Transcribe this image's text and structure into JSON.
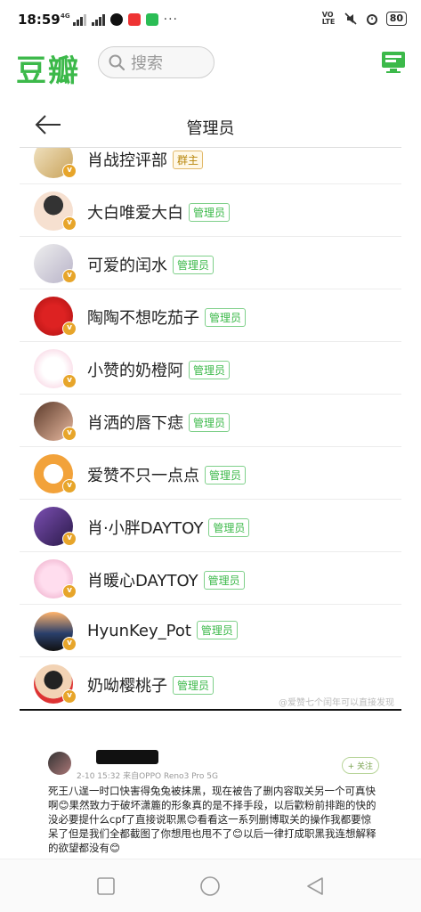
{
  "status_bar": {
    "time": "18:59",
    "network": "4G",
    "battery": "80",
    "volte": "VO LTE"
  },
  "header": {
    "logo": "豆瓣",
    "search_placeholder": "搜索"
  },
  "screenshot": {
    "title": "管理员",
    "members": [
      {
        "name": "肖战控评部",
        "role": "群主",
        "role_type": "owner"
      },
      {
        "name": "大白唯爱大白",
        "role": "管理员",
        "role_type": "admin"
      },
      {
        "name": "可爱的闰水",
        "role": "管理员",
        "role_type": "admin"
      },
      {
        "name": "陶陶不想吃茄子",
        "role": "管理员",
        "role_type": "admin"
      },
      {
        "name": "小赞的奶橙阿",
        "role": "管理员",
        "role_type": "admin"
      },
      {
        "name": "肖洒的唇下痣",
        "role": "管理员",
        "role_type": "admin"
      },
      {
        "name": "爱赞不只一点点",
        "role": "管理员",
        "role_type": "admin"
      },
      {
        "name": "肖·小胖DAYTOY",
        "role": "管理员",
        "role_type": "admin"
      },
      {
        "name": "肖暖心DAYTOY",
        "role": "管理员",
        "role_type": "admin"
      },
      {
        "name": "HyunKey_Pot",
        "role": "管理员",
        "role_type": "admin"
      },
      {
        "name": "奶呦樱桃子",
        "role": "管理员",
        "role_type": "admin"
      }
    ]
  },
  "comment": {
    "meta": "2-10 15:32 来自OPPO Reno3 Pro 5G",
    "follow_label": "+ 关注",
    "body": "死王八逞一时口快害得兔兔被抹黑，现在被告了删内容取关另一个可真快啊😊果然致力于破坏潇簏的形象真的是不择手段，以后歡粉前排跑的快的没必要提什么cpf了直接说职黑😊看看这一系列删博取关的操作我都要惊呆了但是我们全都截图了你想甩也甩不了😊以后一律打成职黑我连想解释的欲望都没有😊"
  },
  "colors": {
    "brand_green": "#3cb94a",
    "owner_gold": "#b8860b",
    "v_badge": "#e7a52a"
  }
}
